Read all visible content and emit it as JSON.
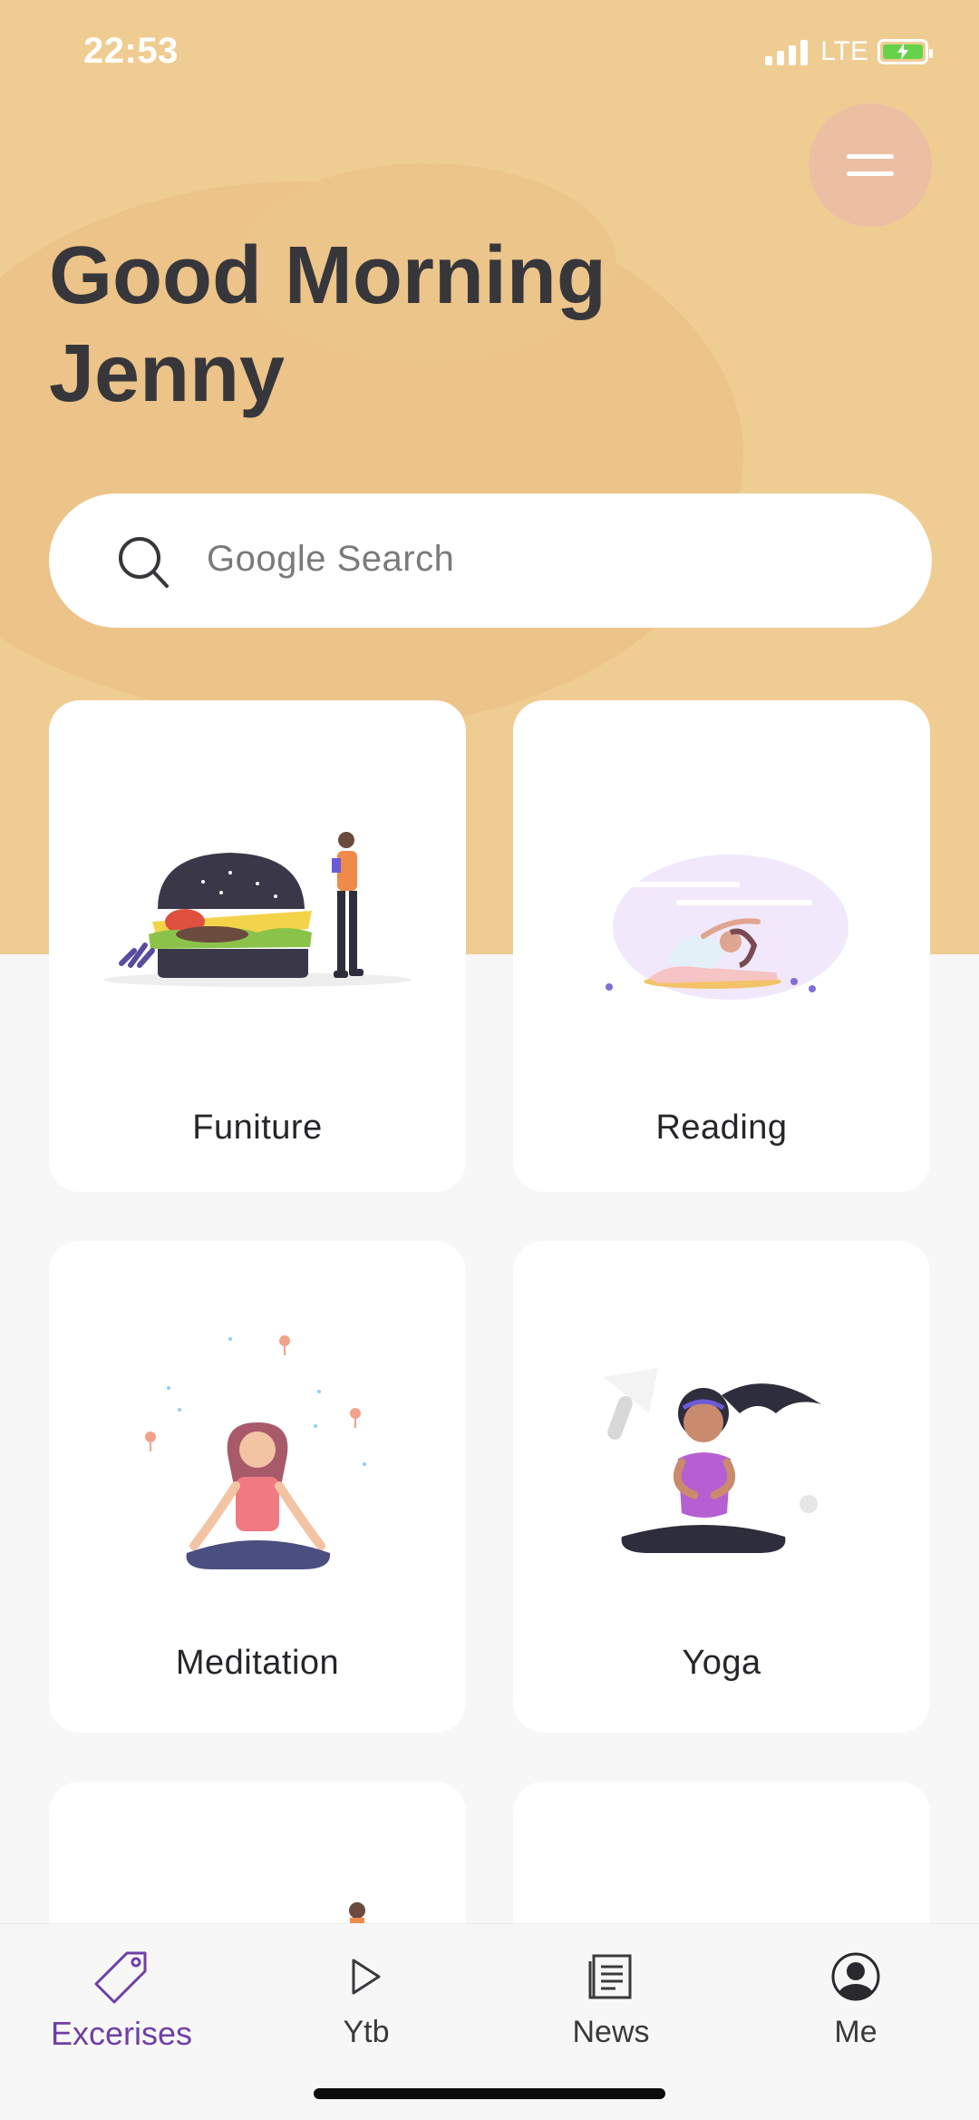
{
  "status_bar": {
    "time": "22:53",
    "network": "LTE"
  },
  "header": {
    "greeting_line1": "Good Morning",
    "greeting_line2": "Jenny",
    "menu_icon": "hamburger-icon"
  },
  "search": {
    "placeholder": "Google Search",
    "icon": "search-icon"
  },
  "cards": [
    {
      "label": "Funiture",
      "icon": "burger-illustration"
    },
    {
      "label": "Reading",
      "icon": "stretching-illustration"
    },
    {
      "label": "Meditation",
      "icon": "meditation-illustration"
    },
    {
      "label": "Yoga",
      "icon": "yoga-illustration"
    }
  ],
  "bottom_nav": {
    "items": [
      {
        "label": "Excerises",
        "icon": "tag-icon",
        "active": true
      },
      {
        "label": "Ytb",
        "icon": "play-icon",
        "active": false
      },
      {
        "label": "News",
        "icon": "news-icon",
        "active": false
      },
      {
        "label": "Me",
        "icon": "profile-icon",
        "active": false
      }
    ]
  },
  "colors": {
    "header_bg": "#efcd92",
    "accent": "#6f3fa6",
    "menu_button": "#ecbfa3",
    "page_bg": "#f7f7f7"
  }
}
